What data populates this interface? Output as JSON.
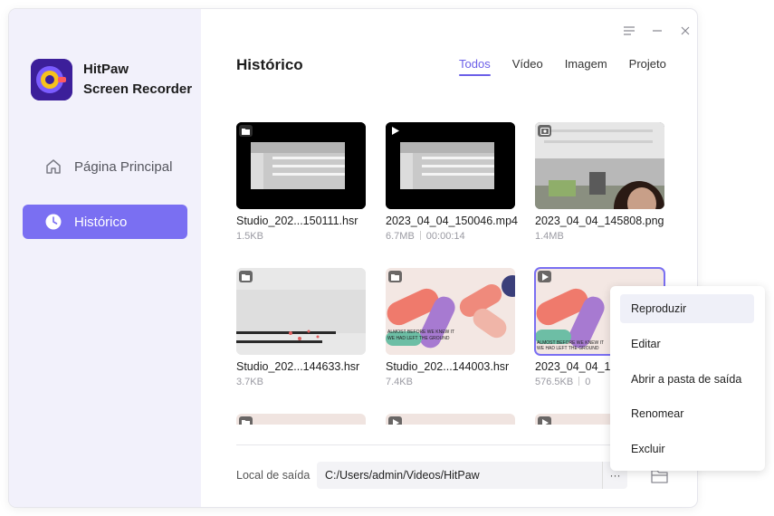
{
  "app": {
    "name_line1": "HitPaw",
    "name_line2": "Screen Recorder",
    "accent": "#7a6ff2",
    "logo_bg": "#4b2aa8"
  },
  "sidebar": {
    "items": [
      {
        "label": "Página Principal",
        "icon": "home-icon"
      },
      {
        "label": "Histórico",
        "icon": "clock-icon",
        "active": true
      }
    ]
  },
  "header": {
    "title": "Histórico",
    "tabs": [
      {
        "label": "Todos",
        "active": true
      },
      {
        "label": "Vídeo"
      },
      {
        "label": "Imagem"
      },
      {
        "label": "Projeto"
      }
    ]
  },
  "files": [
    {
      "name": "Studio_202...150111.hsr",
      "size": "1.5KB",
      "duration": "",
      "type": "project"
    },
    {
      "name": "2023_04_04_150046.mp4",
      "size": "6.7MB",
      "duration": "00:00:14",
      "type": "video"
    },
    {
      "name": "2023_04_04_145808.png",
      "size": "1.4MB",
      "duration": "",
      "type": "image"
    },
    {
      "name": "Studio_202...144633.hsr",
      "size": "3.7KB",
      "duration": "",
      "type": "project"
    },
    {
      "name": "Studio_202...144003.hsr",
      "size": "7.4KB",
      "duration": "",
      "type": "project"
    },
    {
      "name": "2023_04_04_14",
      "size": "576.5KB",
      "duration": "0",
      "type": "video",
      "selected": true
    },
    {
      "name": "",
      "size": "",
      "duration": "",
      "type": "project"
    },
    {
      "name": "",
      "size": "",
      "duration": "",
      "type": "video"
    },
    {
      "name": "",
      "size": "",
      "duration": "",
      "type": "video"
    }
  ],
  "output": {
    "label": "Local de saída",
    "path": "C:/Users/admin/Videos/HitPaw",
    "more": "···"
  },
  "context_menu": {
    "items": [
      "Reproduzir",
      "Editar",
      "Abrir a pasta de saída",
      "Renomear",
      "Excluir"
    ]
  },
  "thumb_text": {
    "line1": "ALMOST BEFORE WE KNEW IT",
    "line2": "WE HAD LEFT THE GROUND"
  }
}
